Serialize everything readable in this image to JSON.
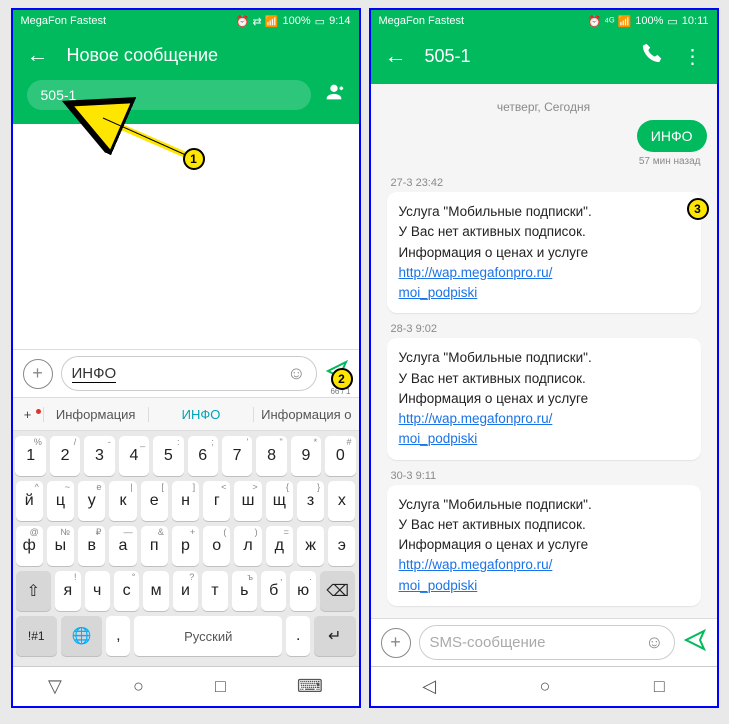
{
  "left": {
    "status": {
      "carrier": "MegaFon Fastest",
      "signal_icons": "⏰ ⇄ 📶",
      "battery": "100%",
      "batt_icon": "▭",
      "time": "9:14"
    },
    "header": {
      "title": "Новое сообщение"
    },
    "recipient": "505-1",
    "input": {
      "text": "ИНФО",
      "count": "66 / 1"
    },
    "suggestions": {
      "left": "Информация",
      "center": "ИНФО",
      "right": "Информация о"
    },
    "keyboard": {
      "row1": [
        {
          "main": "1",
          "sub": "%"
        },
        {
          "main": "2",
          "sub": "/"
        },
        {
          "main": "3",
          "sub": "-"
        },
        {
          "main": "4",
          "sub": "_"
        },
        {
          "main": "5",
          "sub": ":"
        },
        {
          "main": "6",
          "sub": ";"
        },
        {
          "main": "7",
          "sub": "'"
        },
        {
          "main": "8",
          "sub": "\""
        },
        {
          "main": "9",
          "sub": "*"
        },
        {
          "main": "0",
          "sub": "#"
        }
      ],
      "row2": [
        {
          "main": "й",
          "sub": "^"
        },
        {
          "main": "ц",
          "sub": "~"
        },
        {
          "main": "у",
          "sub": "е"
        },
        {
          "main": "к",
          "sub": "|"
        },
        {
          "main": "е",
          "sub": "["
        },
        {
          "main": "н",
          "sub": "]"
        },
        {
          "main": "г",
          "sub": "<"
        },
        {
          "main": "ш",
          "sub": ">"
        },
        {
          "main": "щ",
          "sub": "{"
        },
        {
          "main": "з",
          "sub": "}"
        },
        {
          "main": "х",
          "sub": ""
        }
      ],
      "row3": [
        {
          "main": "ф",
          "sub": "@"
        },
        {
          "main": "ы",
          "sub": "№"
        },
        {
          "main": "в",
          "sub": "₽"
        },
        {
          "main": "а",
          "sub": "—"
        },
        {
          "main": "п",
          "sub": "&"
        },
        {
          "main": "р",
          "sub": "+"
        },
        {
          "main": "о",
          "sub": "("
        },
        {
          "main": "л",
          "sub": ")"
        },
        {
          "main": "д",
          "sub": "="
        },
        {
          "main": "ж",
          "sub": ""
        },
        {
          "main": "э",
          "sub": ""
        }
      ],
      "row4_shift": "⇧",
      "row4": [
        {
          "main": "я",
          "sub": "!"
        },
        {
          "main": "ч",
          "sub": ""
        },
        {
          "main": "с",
          "sub": "°"
        },
        {
          "main": "м",
          "sub": ""
        },
        {
          "main": "и",
          "sub": "?"
        },
        {
          "main": "т",
          "sub": ""
        },
        {
          "main": "ь",
          "sub": "ъ"
        },
        {
          "main": "б",
          "sub": ","
        },
        {
          "main": "ю",
          "sub": "."
        }
      ],
      "row4_bksp": "⌫",
      "row5": {
        "sym": "!#1",
        "globe": "🌐",
        "comma": ",",
        "space": "Русский",
        "dot": ".",
        "enter": "↵"
      }
    },
    "annotations": {
      "b1": "1",
      "b2": "2"
    }
  },
  "right": {
    "status": {
      "carrier": "MegaFon Fastest",
      "signal_icons": "⏰ ⁴ᴳ 📶",
      "battery": "100%",
      "batt_icon": "▭",
      "time": "10:11"
    },
    "header": {
      "title": "505-1"
    },
    "date": "четверг, Сегодня",
    "outgoing": {
      "text": "ИНФО",
      "time": "57 мин назад"
    },
    "messages": [
      {
        "time": "27-3 23:42",
        "lines": [
          "Услуга \"Мобильные подписки\".",
          "У Вас нет активных подписок.",
          "Информация о ценах и услуге"
        ],
        "link1": "http://wap.megafonpro.ru/",
        "link2": "moi_podpiski"
      },
      {
        "time": "28-3 9:02",
        "lines": [
          "Услуга \"Мобильные подписки\".",
          "У Вас нет активных подписок.",
          "Информация о ценах и услуге"
        ],
        "link1": "http://wap.megafonpro.ru/",
        "link2": "moi_podpiski"
      },
      {
        "time": "30-3 9:11",
        "lines": [
          "Услуга \"Мобильные подписки\".",
          "У Вас нет активных подписок.",
          "Информация о ценах и услуге"
        ],
        "link1": "http://wap.megafonpro.ru/",
        "link2": "moi_podpiski"
      }
    ],
    "input_placeholder": "SMS-сообщение",
    "annotations": {
      "b3": "3"
    }
  }
}
